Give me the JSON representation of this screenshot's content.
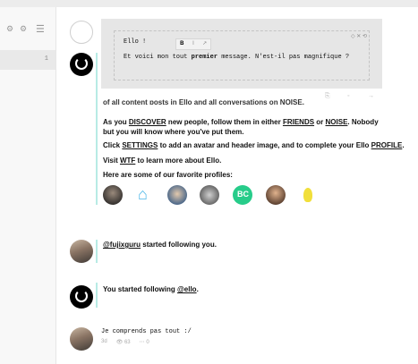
{
  "sidebar": {
    "gear_icon": "⚙",
    "settings_icon": "⚙",
    "menu_icon": "☰",
    "item_count": "1"
  },
  "composer": {
    "line1": "Ello !",
    "line2_before": "Et voici mon tout ",
    "line2_bold": "premier",
    "line2_after": " message. N'est-il pas magnifique ?",
    "format_bold": "B",
    "format_italic": "I",
    "format_link": "↗",
    "tools": "◇ ✕ ⟲"
  },
  "post_actions": {
    "repost": "⎘",
    "share": "◦",
    "forward": "→"
  },
  "welcome": {
    "line_partial": "of all content posts in Ello and all conversations on NOISE.",
    "para1_a": "As you ",
    "para1_discover": "DISCOVER",
    "para1_b": " new people, follow them in either ",
    "para1_friends": "FRIENDS",
    "para1_c": " or ",
    "para1_noise": "NOISE",
    "para1_d": ". Nobody but you will know where you've put them.",
    "para2_a": "Click ",
    "para2_settings": "SETTINGS",
    "para2_b": " to add an avatar and header image, and to complete your Ello ",
    "para2_profile": "PROFILE",
    "para2_c": ".",
    "para3_a": "Visit ",
    "para3_wtf": "WTF",
    "para3_b": " to learn more about Ello.",
    "para4": "Here are some of our favorite profiles:"
  },
  "notifications": {
    "follow_user": "@fujixguru",
    "follow_text": " started following you.",
    "you_started": "You started following ",
    "you_user": "@ello",
    "you_end": "."
  },
  "comment": {
    "text": "Je comprends pas tout :/",
    "age": "3d",
    "views": "👁 63",
    "comments": "⋯ 0"
  },
  "colors": {
    "accent_line": "#b8ebe5",
    "brand": "#000000"
  }
}
